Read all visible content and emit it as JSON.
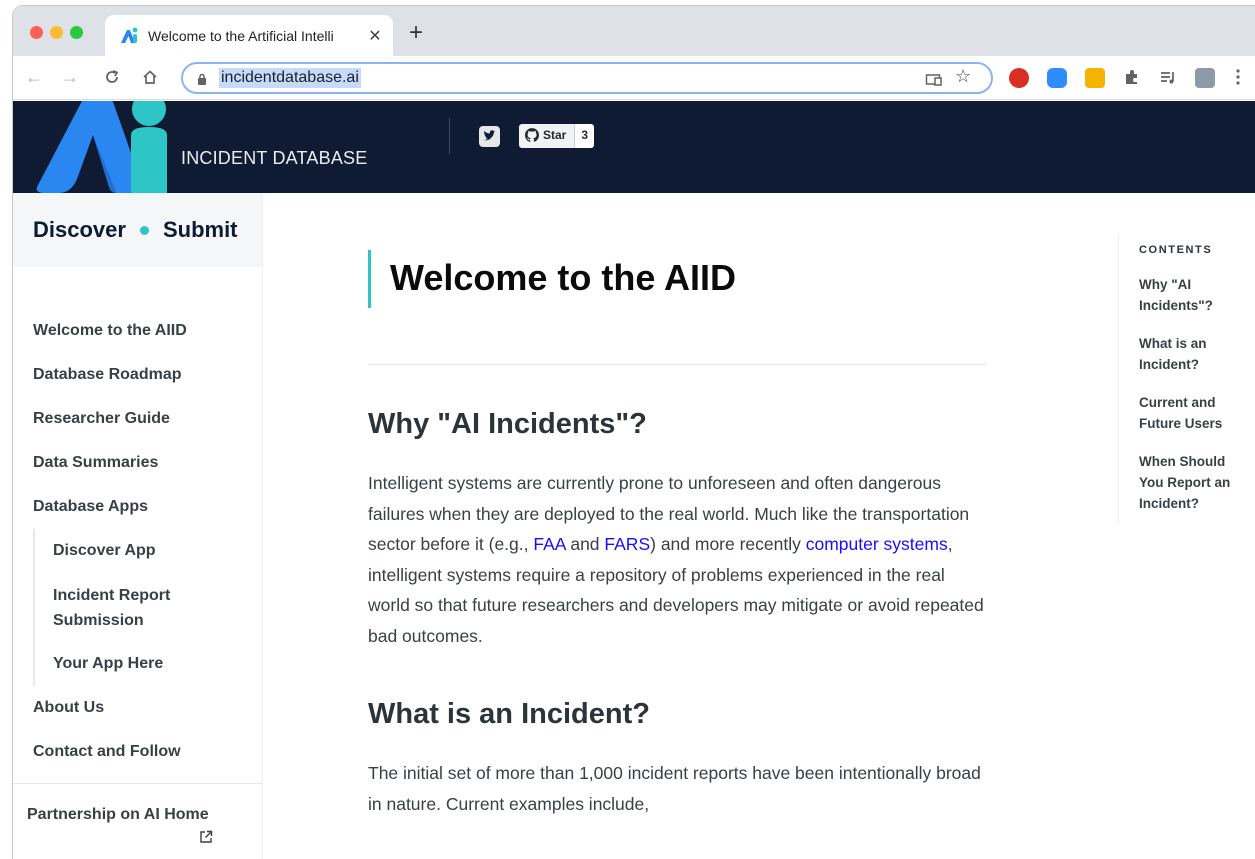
{
  "browser": {
    "tab_title": "Welcome to the Artificial Intelli",
    "tab_close": "✕",
    "new_tab": "+",
    "url": "incidentdatabase.ai"
  },
  "header": {
    "brand": "INCIDENT DATABASE",
    "github_star_label": "Star",
    "github_star_count": "3"
  },
  "sidebar": {
    "top_left": "Discover",
    "top_right": "Submit",
    "items": [
      {
        "label": "Welcome to the AIID"
      },
      {
        "label": "Database Roadmap"
      },
      {
        "label": "Researcher Guide"
      },
      {
        "label": "Data Summaries"
      },
      {
        "label": "Database Apps"
      }
    ],
    "sub_items": [
      {
        "label": "Discover App"
      },
      {
        "label": "Incident Report Submission"
      },
      {
        "label": "Your App Here"
      }
    ],
    "after_items": [
      {
        "label": "About Us"
      },
      {
        "label": "Contact and Follow"
      }
    ],
    "footer_link": "Partnership on AI Home"
  },
  "main": {
    "title": "Welcome to the AIID",
    "section1_heading": "Why \"AI Incidents\"?",
    "p1_a": "Intelligent systems are currently prone to unforeseen and often dangerous failures when they are deployed to the real world. Much like the transportation sector before it (e.g., ",
    "p1_link1": "FAA",
    "p1_b": " and ",
    "p1_link2": "FARS",
    "p1_c": ") and more recently ",
    "p1_link3": "computer systems",
    "p1_d": ", intelligent systems require a repository of problems experienced in the real world so that future researchers and developers may mitigate or avoid repeated bad outcomes.",
    "section2_heading": "What is an Incident?",
    "p2": "The initial set of more than 1,000 incident reports have been intentionally broad in nature. Current examples include,"
  },
  "toc": {
    "heading": "CONTENTS",
    "items": [
      {
        "label": "Why \"AI Incidents\"?"
      },
      {
        "label": "What is an Incident?"
      },
      {
        "label": "Current and Future Users"
      },
      {
        "label": "When Should You Report an Incident?"
      }
    ]
  },
  "colors": {
    "header_bg": "#0f1b33",
    "accent_teal": "#2ec5c7",
    "logo_blue": "#2a86f0",
    "link_blue": "#1a0dff"
  }
}
